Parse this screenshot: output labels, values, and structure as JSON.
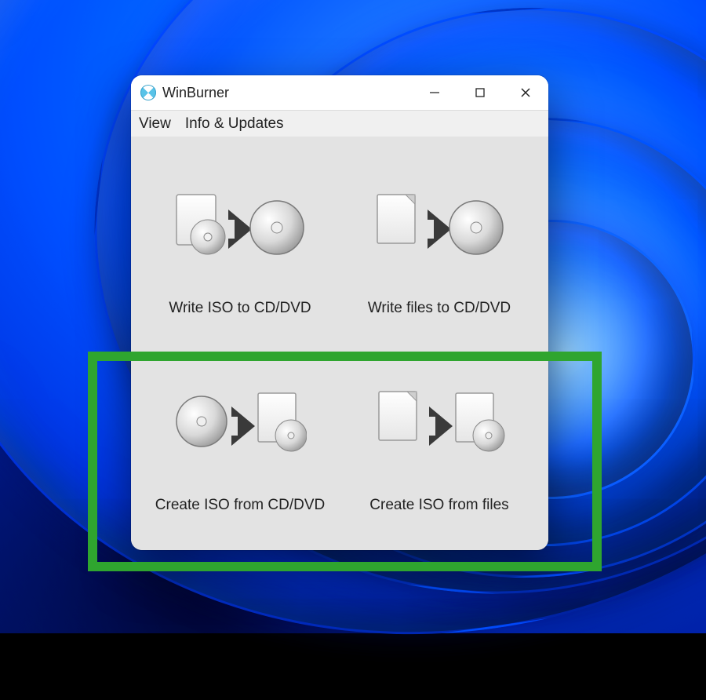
{
  "app": {
    "title": "WinBurner"
  },
  "menu": {
    "view": "View",
    "info": "Info & Updates"
  },
  "actions": {
    "write_iso": "Write ISO to CD/DVD",
    "write_files": "Write files to CD/DVD",
    "create_iso_disc": "Create ISO from CD/DVD",
    "create_iso_files": "Create ISO from files"
  },
  "annotation": {
    "highlight_color": "#2FA52F"
  }
}
